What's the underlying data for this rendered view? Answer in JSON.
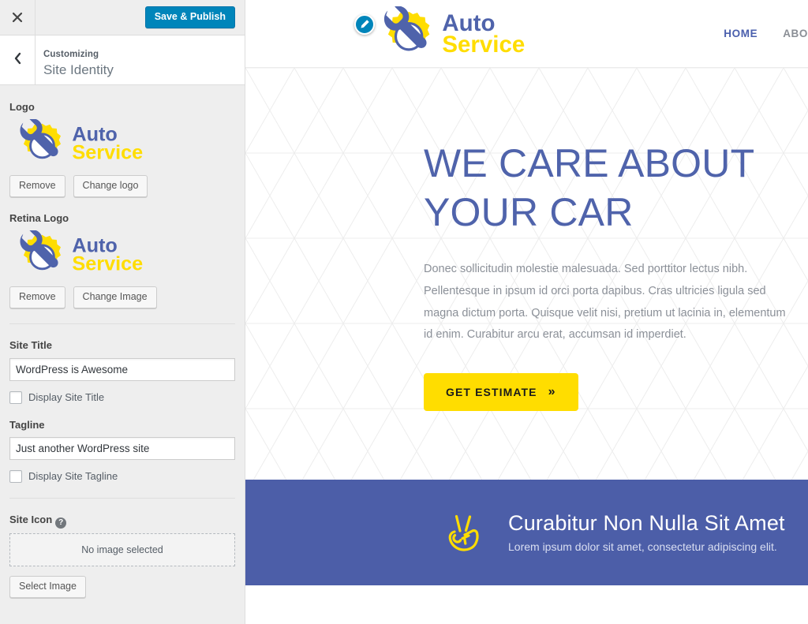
{
  "customizer": {
    "close_icon": "close-x-icon",
    "back_icon": "chevron-left-icon",
    "save_button": "Save & Publish",
    "eyebrow": "Customizing",
    "section_title": "Site Identity",
    "controls": {
      "logo": {
        "label": "Logo",
        "image_alt": "Auto Service",
        "remove_button": "Remove",
        "change_button": "Change logo"
      },
      "retina_logo": {
        "label": "Retina Logo",
        "image_alt": "Auto Service",
        "remove_button": "Remove",
        "change_button": "Change Image"
      },
      "site_title": {
        "label": "Site Title",
        "value": "WordPress is Awesome",
        "checkbox_label": "Display Site Title",
        "checked": false
      },
      "tagline": {
        "label": "Tagline",
        "value": "Just another WordPress site",
        "checkbox_label": "Display Site Tagline",
        "checked": false
      },
      "site_icon": {
        "label": "Site Icon",
        "help_glyph": "?",
        "placeholder": "No image selected",
        "select_button": "Select Image"
      }
    }
  },
  "preview": {
    "edit_shortcut_icon": "pencil-edit-icon",
    "logo": {
      "word_one": "Auto",
      "word_two": "Service",
      "icon": "wrench-gear-icon"
    },
    "nav": [
      {
        "label": "HOME",
        "active": true
      },
      {
        "label": "ABO",
        "active": false
      }
    ],
    "hero": {
      "title": "WE CARE ABOUT YOUR CAR",
      "body": "Donec sollicitudin molestie malesuada. Sed porttitor lectus nibh. Pellentesque in ipsum id orci porta dapibus. Cras ultricies ligula sed magna dictum porta. Quisque velit nisi, pretium ut lacinia in, elementum id enim. Curabitur arcu erat, accumsan id imperdiet.",
      "cta_label": "GET ESTIMATE",
      "cta_chevron": "»"
    },
    "promo": {
      "icon": "victory-hand-icon",
      "title": "Curabitur Non Nulla Sit Amet",
      "subtitle": "Lorem ipsum dolor sit amet, consectetur adipiscing elit."
    }
  },
  "colors": {
    "wp_blue": "#0085ba",
    "brand_blue": "#4f63ab",
    "brand_yellow": "#ffdd00",
    "promo_bg": "#4c5ea8",
    "sidebar_bg": "#eeeeee"
  }
}
